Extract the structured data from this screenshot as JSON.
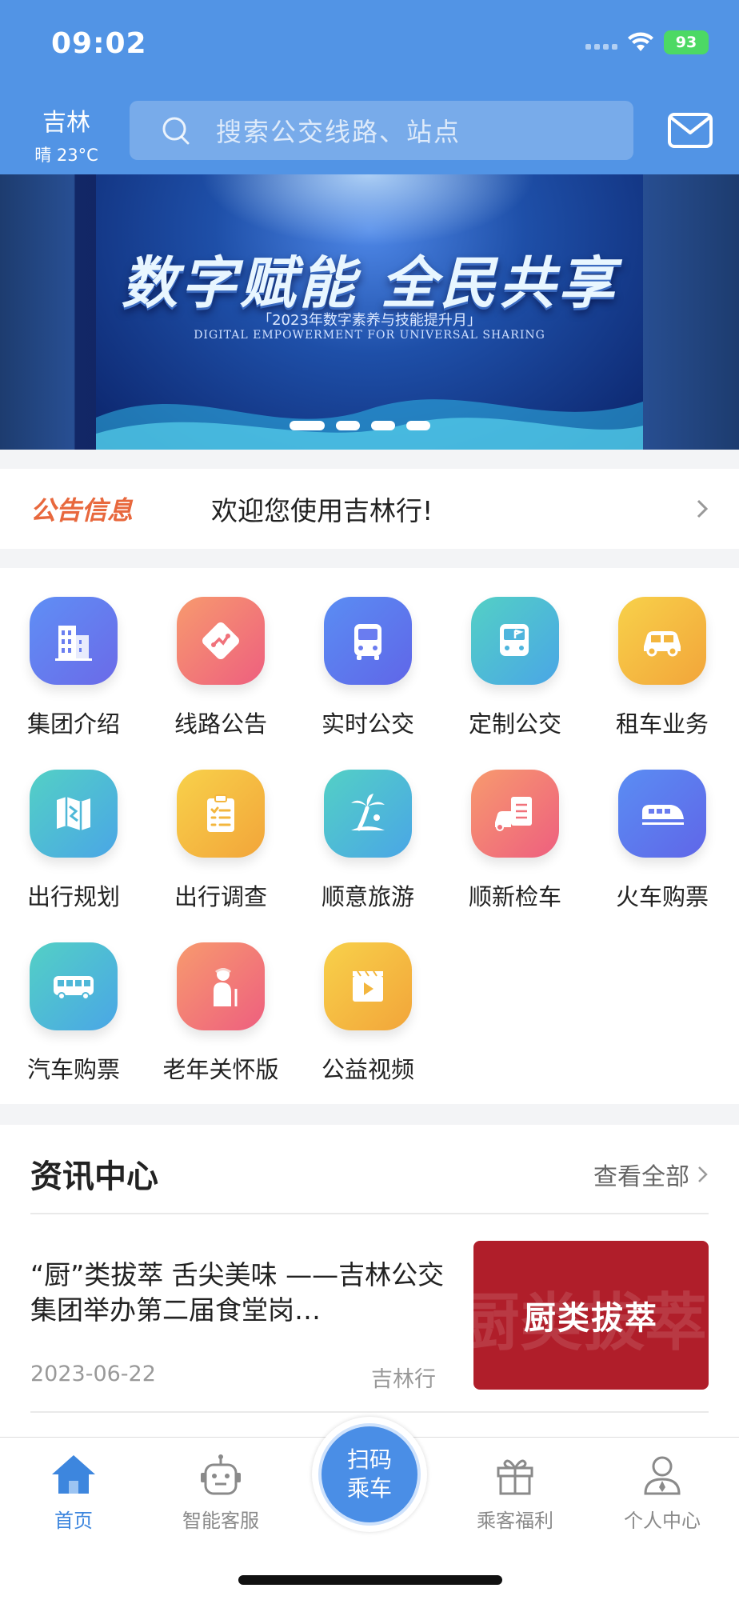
{
  "status": {
    "time": "09:02",
    "battery": "93"
  },
  "header": {
    "city": "吉林",
    "weather": "晴 23°C",
    "search_placeholder": "搜索公交线路、站点",
    "brand_color": "#5294e5"
  },
  "banner": {
    "title": "数字赋能 全民共享",
    "subtitle": "「2023年数字素养与技能提升月」",
    "english": "DIGITAL EMPOWERMENT FOR UNIVERSAL SHARING",
    "page_count": 4,
    "active_page": 1
  },
  "notice": {
    "tag": "公告信息",
    "text": "欢迎您使用吉林行!"
  },
  "services": [
    {
      "label": "集团介绍",
      "icon": "building-icon"
    },
    {
      "label": "线路公告",
      "icon": "route-sign-icon"
    },
    {
      "label": "实时公交",
      "icon": "bus-front-icon"
    },
    {
      "label": "定制公交",
      "icon": "custom-bus-icon"
    },
    {
      "label": "租车业务",
      "icon": "car-icon"
    },
    {
      "label": "出行规划",
      "icon": "map-icon"
    },
    {
      "label": "出行调查",
      "icon": "clipboard-icon"
    },
    {
      "label": "顺意旅游",
      "icon": "palm-tree-icon"
    },
    {
      "label": "顺新检车",
      "icon": "car-inspection-icon"
    },
    {
      "label": "火车购票",
      "icon": "train-icon"
    },
    {
      "label": "汽车购票",
      "icon": "coach-bus-icon"
    },
    {
      "label": "老年关怀版",
      "icon": "elderly-icon"
    },
    {
      "label": "公益视频",
      "icon": "video-icon"
    }
  ],
  "news": {
    "title": "资讯中心",
    "more": "查看全部",
    "article": {
      "title": "“厨”类拔萃 舌尖美味 ——吉林公交集团举办第二届食堂岗…",
      "date": "2023-06-22",
      "source": "吉林行",
      "thumb_text": "厨类拔萃"
    }
  },
  "tabbar": {
    "home": "首页",
    "service": "智能客服",
    "scan_line1": "扫码",
    "scan_line2": "乘车",
    "benefits": "乘客福利",
    "profile": "个人中心",
    "active_color": "#3d86de",
    "inactive_color": "#8a8a8a"
  }
}
